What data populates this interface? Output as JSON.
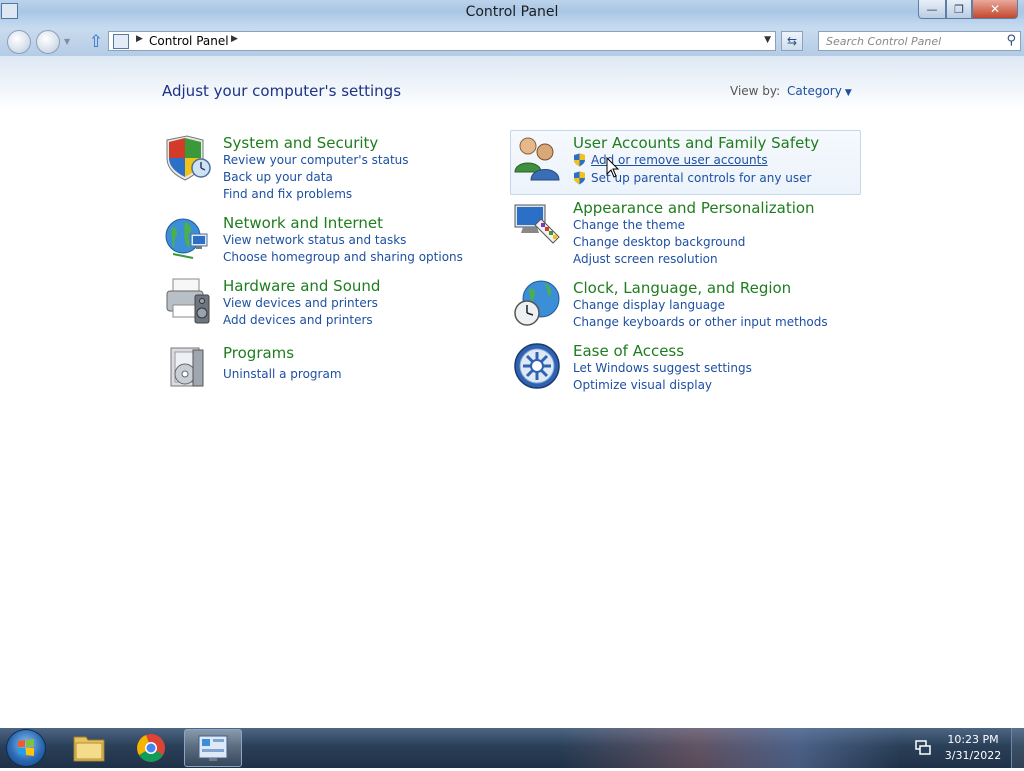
{
  "window": {
    "title": "Control Panel",
    "buttons": {
      "minimize": "—",
      "maximize": "❐",
      "close": "✕"
    }
  },
  "navbar": {
    "breadcrumb": "Control Panel",
    "search_placeholder": "Search Control Panel"
  },
  "content": {
    "heading": "Adjust your computer's settings",
    "view_by_label": "View by:",
    "view_by_value": "Category",
    "categories": [
      {
        "title": "System and Security",
        "icon": "shield-icon",
        "links": [
          "Review your computer's status",
          "Back up your data",
          "Find and fix problems"
        ]
      },
      {
        "title": "Network and Internet",
        "icon": "globe-network-icon",
        "links": [
          "View network status and tasks",
          "Choose homegroup and sharing options"
        ]
      },
      {
        "title": "Hardware and Sound",
        "icon": "printer-speaker-icon",
        "links": [
          "View devices and printers",
          "Add devices and printers"
        ]
      },
      {
        "title": "Programs",
        "icon": "programs-icon",
        "links": [
          "Uninstall a program"
        ]
      },
      {
        "title": "User Accounts and Family Safety",
        "icon": "users-icon",
        "links": [
          "Add or remove user accounts",
          "Set up parental controls for any user"
        ]
      },
      {
        "title": "Appearance and Personalization",
        "icon": "monitor-palette-icon",
        "links": [
          "Change the theme",
          "Change desktop background",
          "Adjust screen resolution"
        ]
      },
      {
        "title": "Clock, Language, and Region",
        "icon": "clock-globe-icon",
        "links": [
          "Change display language",
          "Change keyboards or other input methods"
        ]
      },
      {
        "title": "Ease of Access",
        "icon": "ease-of-access-icon",
        "links": [
          "Let Windows suggest settings",
          "Optimize visual display"
        ]
      }
    ]
  },
  "taskbar": {
    "time": "10:23 PM",
    "date": "3/31/2022",
    "pinned": [
      "file-explorer-icon",
      "chrome-icon",
      "control-panel-icon"
    ]
  },
  "colors": {
    "category_title": "#1e7d1e",
    "link": "#1e50a2",
    "heading": "#1e3287"
  }
}
